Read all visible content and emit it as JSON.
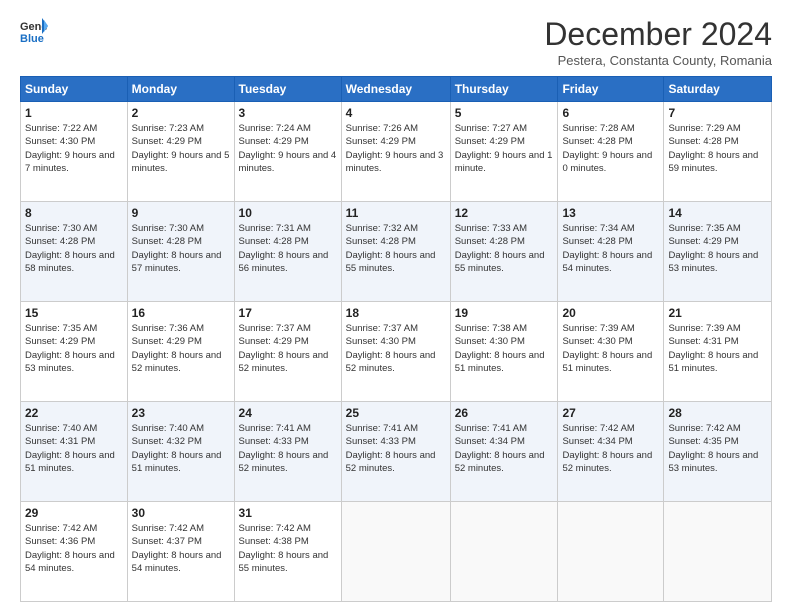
{
  "logo": {
    "general": "General",
    "blue": "Blue"
  },
  "header": {
    "month_title": "December 2024",
    "subtitle": "Pestera, Constanta County, Romania"
  },
  "days_of_week": [
    "Sunday",
    "Monday",
    "Tuesday",
    "Wednesday",
    "Thursday",
    "Friday",
    "Saturday"
  ],
  "weeks": [
    [
      {
        "day": "1",
        "info": "Sunrise: 7:22 AM\nSunset: 4:30 PM\nDaylight: 9 hours and 7 minutes."
      },
      {
        "day": "2",
        "info": "Sunrise: 7:23 AM\nSunset: 4:29 PM\nDaylight: 9 hours and 5 minutes."
      },
      {
        "day": "3",
        "info": "Sunrise: 7:24 AM\nSunset: 4:29 PM\nDaylight: 9 hours and 4 minutes."
      },
      {
        "day": "4",
        "info": "Sunrise: 7:26 AM\nSunset: 4:29 PM\nDaylight: 9 hours and 3 minutes."
      },
      {
        "day": "5",
        "info": "Sunrise: 7:27 AM\nSunset: 4:29 PM\nDaylight: 9 hours and 1 minute."
      },
      {
        "day": "6",
        "info": "Sunrise: 7:28 AM\nSunset: 4:28 PM\nDaylight: 9 hours and 0 minutes."
      },
      {
        "day": "7",
        "info": "Sunrise: 7:29 AM\nSunset: 4:28 PM\nDaylight: 8 hours and 59 minutes."
      }
    ],
    [
      {
        "day": "8",
        "info": "Sunrise: 7:30 AM\nSunset: 4:28 PM\nDaylight: 8 hours and 58 minutes."
      },
      {
        "day": "9",
        "info": "Sunrise: 7:30 AM\nSunset: 4:28 PM\nDaylight: 8 hours and 57 minutes."
      },
      {
        "day": "10",
        "info": "Sunrise: 7:31 AM\nSunset: 4:28 PM\nDaylight: 8 hours and 56 minutes."
      },
      {
        "day": "11",
        "info": "Sunrise: 7:32 AM\nSunset: 4:28 PM\nDaylight: 8 hours and 55 minutes."
      },
      {
        "day": "12",
        "info": "Sunrise: 7:33 AM\nSunset: 4:28 PM\nDaylight: 8 hours and 55 minutes."
      },
      {
        "day": "13",
        "info": "Sunrise: 7:34 AM\nSunset: 4:28 PM\nDaylight: 8 hours and 54 minutes."
      },
      {
        "day": "14",
        "info": "Sunrise: 7:35 AM\nSunset: 4:29 PM\nDaylight: 8 hours and 53 minutes."
      }
    ],
    [
      {
        "day": "15",
        "info": "Sunrise: 7:35 AM\nSunset: 4:29 PM\nDaylight: 8 hours and 53 minutes."
      },
      {
        "day": "16",
        "info": "Sunrise: 7:36 AM\nSunset: 4:29 PM\nDaylight: 8 hours and 52 minutes."
      },
      {
        "day": "17",
        "info": "Sunrise: 7:37 AM\nSunset: 4:29 PM\nDaylight: 8 hours and 52 minutes."
      },
      {
        "day": "18",
        "info": "Sunrise: 7:37 AM\nSunset: 4:30 PM\nDaylight: 8 hours and 52 minutes."
      },
      {
        "day": "19",
        "info": "Sunrise: 7:38 AM\nSunset: 4:30 PM\nDaylight: 8 hours and 51 minutes."
      },
      {
        "day": "20",
        "info": "Sunrise: 7:39 AM\nSunset: 4:30 PM\nDaylight: 8 hours and 51 minutes."
      },
      {
        "day": "21",
        "info": "Sunrise: 7:39 AM\nSunset: 4:31 PM\nDaylight: 8 hours and 51 minutes."
      }
    ],
    [
      {
        "day": "22",
        "info": "Sunrise: 7:40 AM\nSunset: 4:31 PM\nDaylight: 8 hours and 51 minutes."
      },
      {
        "day": "23",
        "info": "Sunrise: 7:40 AM\nSunset: 4:32 PM\nDaylight: 8 hours and 51 minutes."
      },
      {
        "day": "24",
        "info": "Sunrise: 7:41 AM\nSunset: 4:33 PM\nDaylight: 8 hours and 52 minutes."
      },
      {
        "day": "25",
        "info": "Sunrise: 7:41 AM\nSunset: 4:33 PM\nDaylight: 8 hours and 52 minutes."
      },
      {
        "day": "26",
        "info": "Sunrise: 7:41 AM\nSunset: 4:34 PM\nDaylight: 8 hours and 52 minutes."
      },
      {
        "day": "27",
        "info": "Sunrise: 7:42 AM\nSunset: 4:34 PM\nDaylight: 8 hours and 52 minutes."
      },
      {
        "day": "28",
        "info": "Sunrise: 7:42 AM\nSunset: 4:35 PM\nDaylight: 8 hours and 53 minutes."
      }
    ],
    [
      {
        "day": "29",
        "info": "Sunrise: 7:42 AM\nSunset: 4:36 PM\nDaylight: 8 hours and 54 minutes."
      },
      {
        "day": "30",
        "info": "Sunrise: 7:42 AM\nSunset: 4:37 PM\nDaylight: 8 hours and 54 minutes."
      },
      {
        "day": "31",
        "info": "Sunrise: 7:42 AM\nSunset: 4:38 PM\nDaylight: 8 hours and 55 minutes."
      },
      null,
      null,
      null,
      null
    ]
  ]
}
